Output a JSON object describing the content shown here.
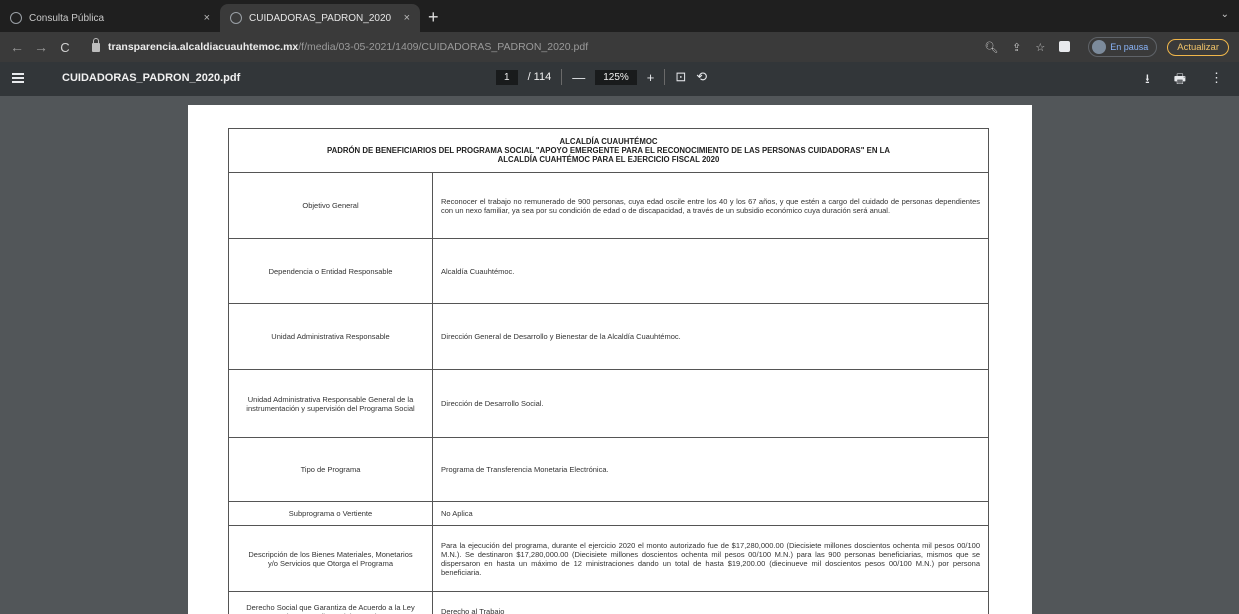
{
  "browser": {
    "tabs": [
      {
        "title": "Consulta Pública",
        "close": "×"
      },
      {
        "title": "CUIDADORAS_PADRON_2020",
        "close": "×"
      }
    ],
    "new_tab": "+",
    "tab_menu": "⌄",
    "address": {
      "host": "transparencia.alcaldiacuauhtemoc.mx",
      "path": "/f/media/03-05-2021/1409/CUIDADORAS_PADRON_2020.pdf"
    },
    "profile_label": "En pausa",
    "update_label": "Actualizar"
  },
  "pdf": {
    "filename": "CUIDADORAS_PADRON_2020.pdf",
    "page_current": "1",
    "page_total": "/ 114",
    "zoom": "125%",
    "zoom_out": "—",
    "zoom_in": "+"
  },
  "document": {
    "header": [
      "ALCALDÍA CUAUHTÉMOC",
      "PADRÓN DE BENEFICIARIOS DEL PROGRAMA SOCIAL \"APOYO EMERGENTE PARA EL RECONOCIMIENTO DE LAS PERSONAS CUIDADORAS\" EN LA",
      "ALCALDÍA CUAHTÉMOC PARA EL EJERCICIO FISCAL 2020"
    ],
    "rows": [
      {
        "label": "Objetivo General",
        "value": "Reconocer el trabajo no remunerado de 900 personas, cuya edad oscile entre los 40 y los 67 años, y que estén a cargo del cuidado de personas dependientes con un nexo familiar, ya sea por su condición de edad o de discapacidad, a través de un subsidio económico cuya duración será anual."
      },
      {
        "label": "Dependencia o Entidad Responsable",
        "value": "Alcaldía Cuauhtémoc."
      },
      {
        "label": "Unidad Administrativa Responsable",
        "value": "Dirección General de Desarrollo y Bienestar de la Alcaldía Cuauhtémoc."
      },
      {
        "label": "Unidad Administrativa Responsable General de la instrumentación y supervisión del Programa Social",
        "value": "Dirección de Desarrollo Social."
      },
      {
        "label": "Tipo de Programa",
        "value": "Programa de Transferencia Monetaria Electrónica."
      },
      {
        "label": "Subprograma o Vertiente",
        "value": "No Aplica"
      },
      {
        "label": "Descripción de los Bienes Materiales, Monetarios y/o Servicios que Otorga el Programa",
        "value": "Para la ejecución del programa, durante el ejercicio 2020 el monto autorizado fue de $17,280,000.00 (Diecisiete millones doscientos ochenta mil pesos 00/100 M.N.). Se destinaron $17,280,000.00 (Diecisiete millones doscientos ochenta mil pesos 00/100 M.N.) para las 900 personas beneficiarias, mismos que se dispersaron en hasta un máximo de 12 ministraciones dando un total de hasta $19,200.00 (diecinueve mil doscientos pesos 00/100 M.N.) por persona beneficiaria."
      },
      {
        "label": "Derecho Social que Garantiza de Acuerdo a la Ley de Desarrollo Social para el",
        "value": "Derecho al Trabajo"
      }
    ]
  }
}
